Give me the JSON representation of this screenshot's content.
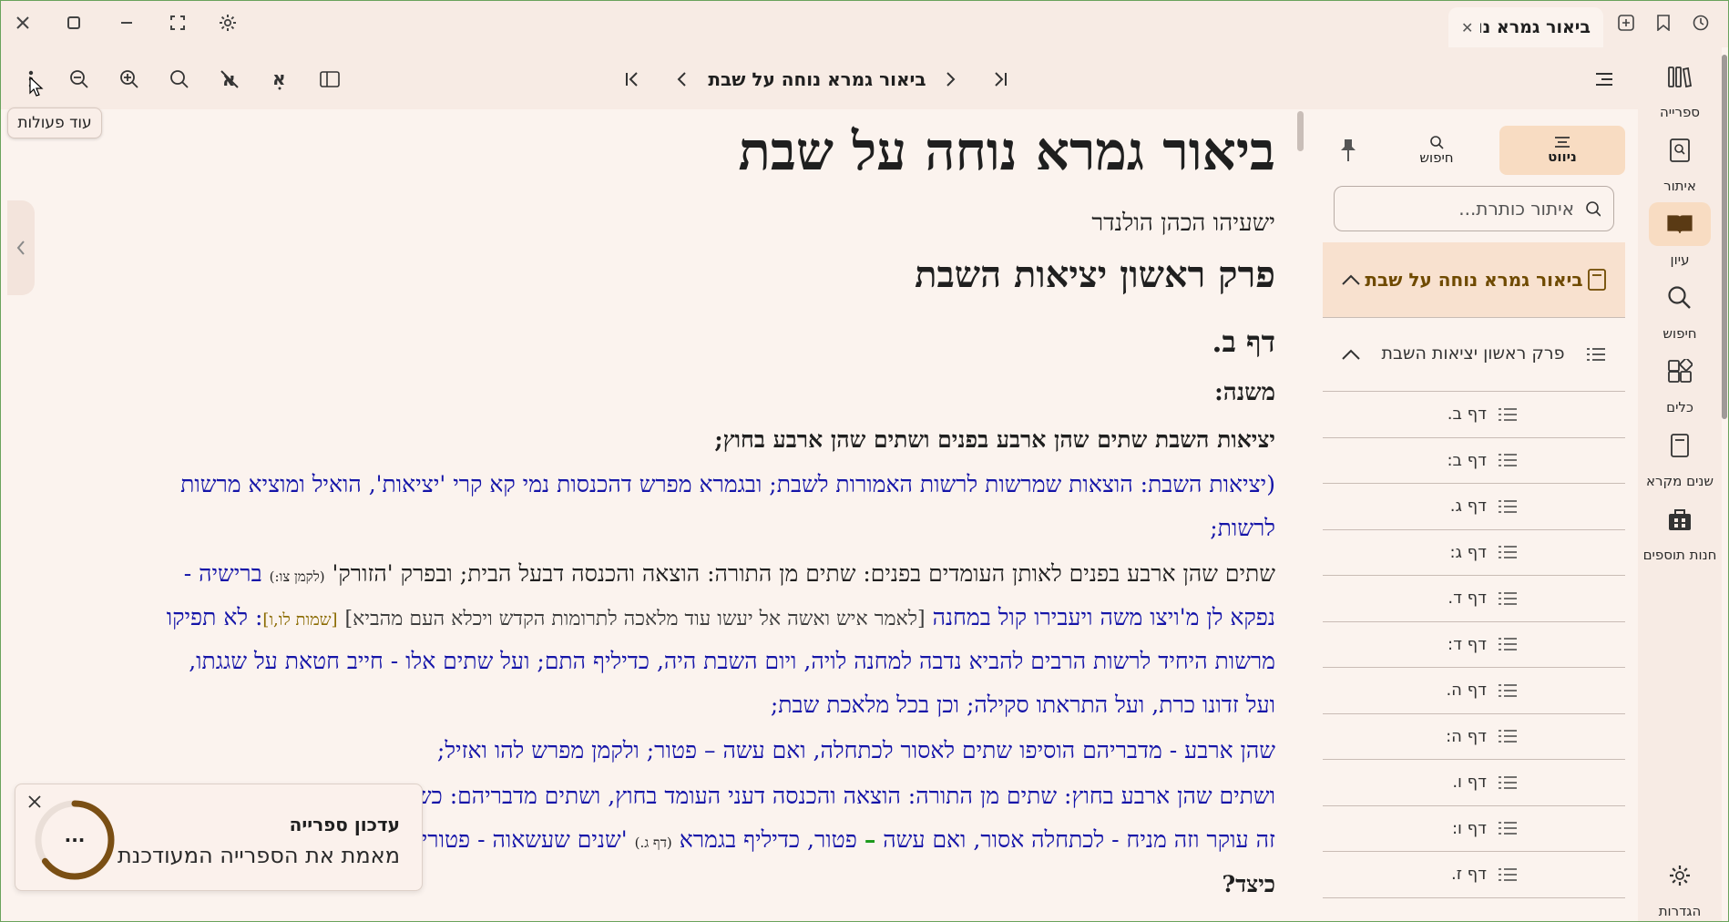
{
  "tab": {
    "title": "ביאור גמרא נו",
    "close": "✕"
  },
  "toolbar": {
    "title": "ביאור גמרא נוחה על שבת",
    "tooltip": "עוד פעולות"
  },
  "content": {
    "title": "ביאור גמרא נוחה על שבת",
    "author": "ישעיהו הכהן הולנדר",
    "chapter": "פרק ראשון יציאות השבת",
    "daf": "דף ב.",
    "mishna": "משנה:",
    "l1": "יציאות השבת שתים שהן ארבע בפנים ושתים שהן ארבע בחוץ;",
    "l2": "(יציאות השבת: הוצאות שמרשות לרשות האמורות לשבת; ובגמרא מפרש דהכנסות נמי קא קרי 'יציאות', הואיל ומוציא מרשות",
    "l3": "לרשות;",
    "l4a": "שתים שהן ארבע בפנים לאותן העומדים בפנים: שתים מן התורה: הוצאה והכנסה דבעל הבית; ובפרק 'הזורק'",
    "l4ref": "(לקמן צו:)",
    "l4b": "ברישיה -",
    "l5a": "נפקא לן מ'ויצו משה ויעבירו קול במחנה",
    "l5b": "[לאמר איש ואשה אל יעשו עוד מלאכה לתרומות הקדש ויכלא העם מהביא]",
    "l5ref": "[שמות לו,ו]",
    "l5c": ": לא תפיקו",
    "l6": "מרשות היחיד לרשות הרבים להביא נדבה למחנה לויה, ויום השבת היה, כדיליף התם; ועל שתים אלו - חייב חטאת על שגגתו,",
    "l7": "ועל זדונו כרת, ועל התראתו סקילה; וכן בכל מלאכת שבת;",
    "l8": "שהן ארבע - מדבריהם הוסיפו שתים לאסור לכתחלה, ואם עשה – פטור; ולקמן מפרש להו ואזיל;",
    "l9": "ושתים שהן ארבע בחוץ: שתים מן התורה: הוצאה והכנסה דעני העומד בחוץ, ושתים מדבריהם: כשמלאכה נעשית על ידי שניהם,",
    "l10a": "זה עוקר וזה מניח - לכתחלה אסור, ואם עשה",
    "l10dash": "–",
    "l10b": "פטור, כדיליף בגמרא",
    "l10ref": "(דף ג.)",
    "l10c": "'שנים שעשאוה - פטורין'",
    "l11": "כיצד?"
  },
  "notification": {
    "title": "עדכון ספרייה",
    "message": "מאמת את הספרייה המעודכנת",
    "progress_label": "...",
    "progress": 0.65
  },
  "toc": {
    "tab_navigation": "ניווט",
    "tab_search": "חיפוש",
    "search_placeholder": "איתור כותרת...",
    "book": "ביאור גמרא נוחה על שבת",
    "chapter": "פרק ראשון יציאות השבת",
    "items": [
      "דף ב.",
      "דף ב:",
      "דף ג.",
      "דף ג:",
      "דף ד.",
      "דף ד:",
      "דף ה.",
      "דף ה:",
      "דף ו.",
      "דף ו:",
      "דף ז."
    ]
  },
  "rail": {
    "library": "ספרייה",
    "find": "איתור",
    "study": "עיון",
    "search": "חיפוש",
    "tools": "כלים",
    "tanakh": "שנים מקרא",
    "addons": "חנות תוספים",
    "settings": "הגדרות"
  },
  "colors": {
    "accent": "#f8dcc2",
    "commentary_blue": "#1414a8",
    "reference_gold": "#8a6a00"
  }
}
